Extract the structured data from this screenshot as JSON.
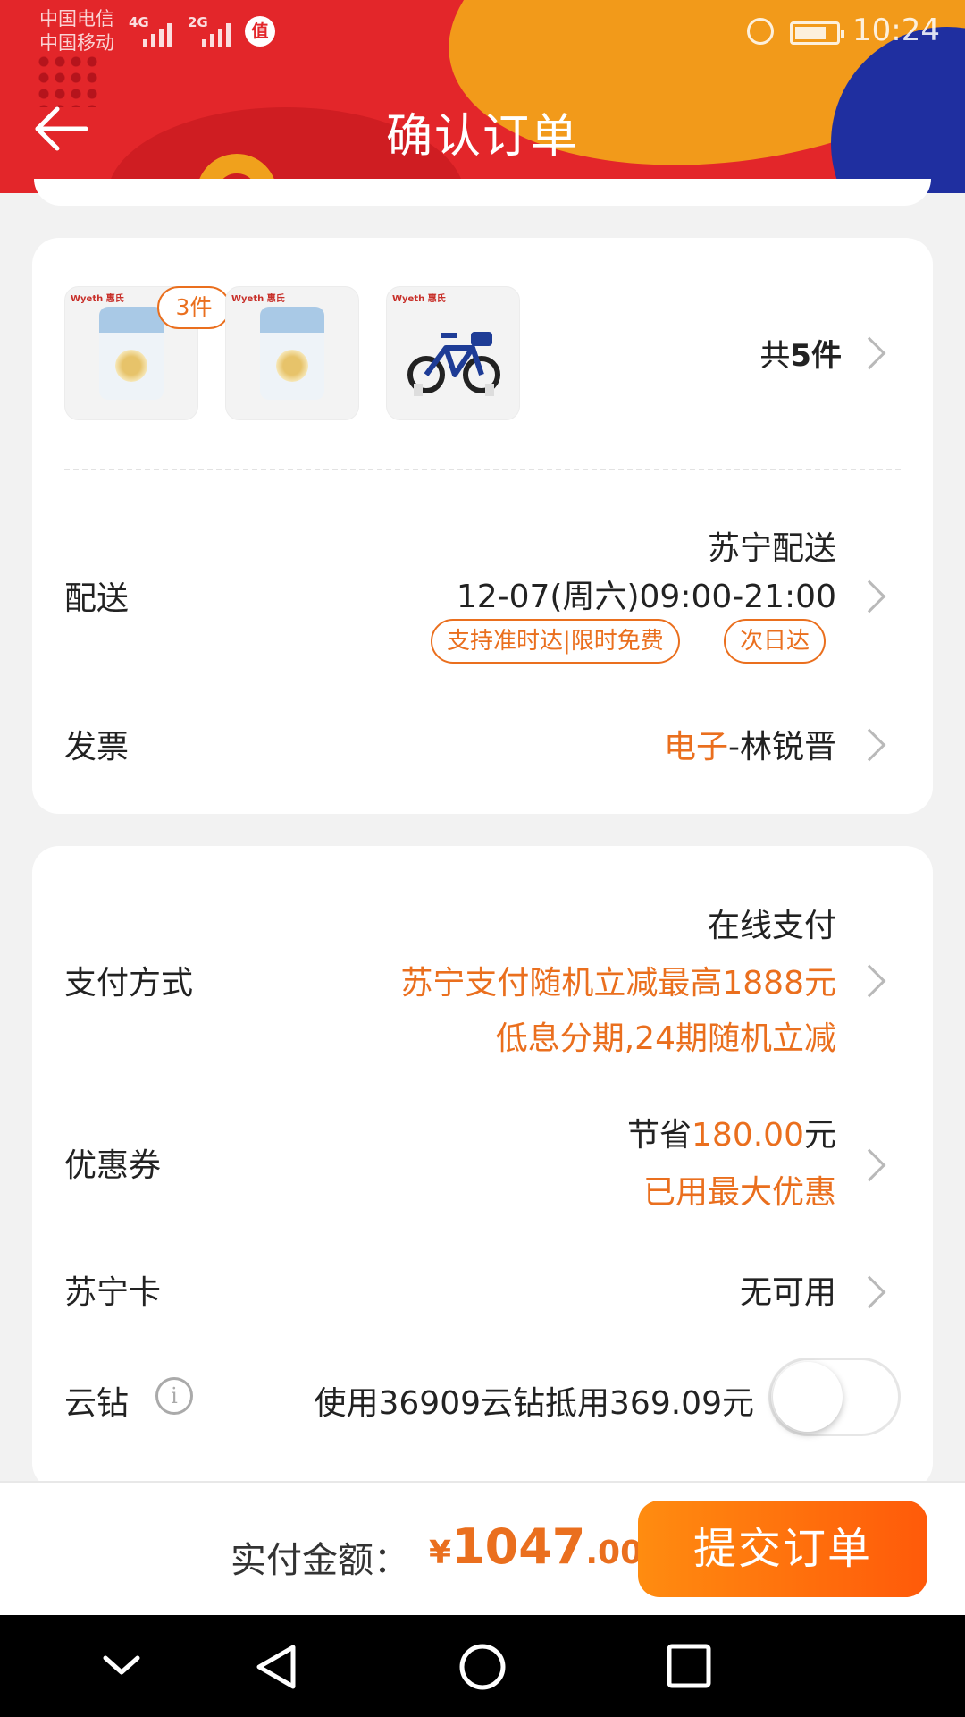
{
  "status_bar": {
    "carrier1": "中国电信",
    "carrier2": "中国移动",
    "net1": "4G",
    "net2": "2G",
    "badge": "值",
    "time": "10:24"
  },
  "header": {
    "title": "确认订单"
  },
  "products": {
    "thumb_brand": "Wyeth 惠氏",
    "quantity_badge": "3件",
    "total_prefix": "共",
    "total_count": "5件"
  },
  "delivery": {
    "label": "配送",
    "method": "苏宁配送",
    "time": "12-07(周六)09:00-21:00",
    "tags": [
      "支持准时达|限时免费",
      "次日达"
    ]
  },
  "invoice": {
    "label": "发票",
    "type": "电子",
    "name": "-林锐晋"
  },
  "payment": {
    "label": "支付方式",
    "method": "在线支付",
    "promo1": "苏宁支付随机立减最高1888元",
    "promo2": "低息分期,24期随机立减"
  },
  "coupon": {
    "label": "优惠券",
    "save_prefix": "节省",
    "save_amount": "180.00",
    "save_suffix": "元",
    "status": "已用最大优惠"
  },
  "suning_card": {
    "label": "苏宁卡",
    "value": "无可用"
  },
  "cloud_diamond": {
    "label": "云钻",
    "info_icon": "i",
    "text": "使用36909云钻抵用369.09元",
    "enabled": false
  },
  "footer": {
    "pay_label": "实付金额：",
    "currency": "¥",
    "amount_int": "1047",
    "amount_dec": ".00",
    "submit": "提交订单"
  },
  "colors": {
    "accent": "#ea6f1e",
    "header_red": "#e3262a"
  }
}
